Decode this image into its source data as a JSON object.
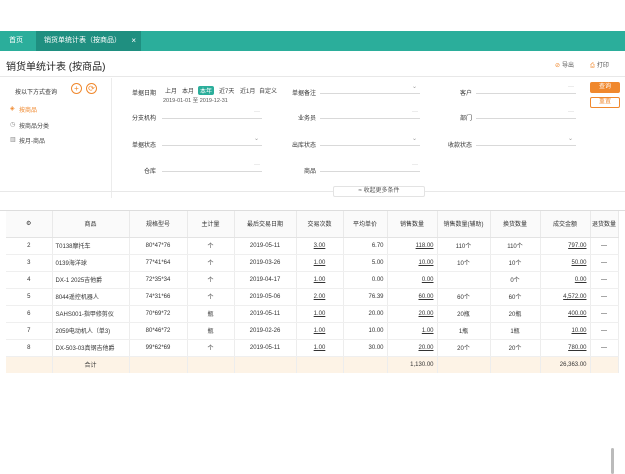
{
  "tabs": {
    "home": "首页",
    "active": "销货单统计表（按商品）",
    "close": "×"
  },
  "page": {
    "title": "销货单统计表 (按商品)",
    "export": "导出",
    "print": "打印"
  },
  "sidebar": {
    "heading": "按以下方式查询",
    "add": "+",
    "refresh": "⟳",
    "items": [
      {
        "label": "按商品",
        "icon": "goods-icon"
      },
      {
        "label": "按商品分类",
        "icon": "clock-icon"
      },
      {
        "label": "按月-商品",
        "icon": "chart-icon"
      }
    ]
  },
  "filters": {
    "doc_date_label": "单据日期",
    "date_options": [
      "上月",
      "本月",
      "本年",
      "近7天",
      "近1月",
      "自定义"
    ],
    "selected_option": "本年",
    "date_start": "2019-01-01",
    "date_end": "2019-12-31",
    "date_sep": "至",
    "doc_remark_label": "单据备注",
    "customer_label": "客户",
    "branch_label": "分支机构",
    "salesman_label": "业务员",
    "department_label": "部门",
    "doc_status_label": "单据状态",
    "outbound_status_label": "出库状态",
    "payment_status_label": "收款状态",
    "warehouse_label": "仓库",
    "goods_label": "商品",
    "query": "查询",
    "reset": "重置",
    "collapse": "收起更多条件"
  },
  "table": {
    "gear": "⚙",
    "columns": [
      "商品",
      "规格型号",
      "主计量",
      "最后交易日期",
      "交易次数",
      "平均单价",
      "销售数量",
      "销售数量(辅助)",
      "换货数量",
      "成交金额",
      "退货数量"
    ],
    "rows": [
      {
        "no": "2",
        "goods": "T0138摩托车",
        "spec": "80*47*76",
        "unit": "个",
        "last_date": "2019-05-11",
        "trades": "3.00",
        "avg_price": "6.70",
        "qty": "118.00",
        "qty_aux": "110个",
        "exchange": "110个",
        "amount": "797.00",
        "ret": "—"
      },
      {
        "no": "3",
        "goods": "0139海洋球",
        "spec": "77*41*64",
        "unit": "个",
        "last_date": "2019-03-26",
        "trades": "1.00",
        "avg_price": "5.00",
        "qty": "10.00",
        "qty_aux": "10个",
        "exchange": "10个",
        "amount": "50.00",
        "ret": "—"
      },
      {
        "no": "4",
        "goods": "DX-1 2025吉他爵",
        "spec": "72*35*34",
        "unit": "个",
        "last_date": "2019-04-17",
        "trades": "1.00",
        "avg_price": "0.00",
        "qty": "0.00",
        "qty_aux": "",
        "exchange": "0个",
        "amount": "0.00",
        "ret": "—"
      },
      {
        "no": "5",
        "goods": "8044遥控机器人",
        "spec": "74*31*66",
        "unit": "个",
        "last_date": "2019-05-06",
        "trades": "2.00",
        "avg_price": "76.39",
        "qty": "60.00",
        "qty_aux": "60个",
        "exchange": "60个",
        "amount": "4,572.00",
        "ret": "—"
      },
      {
        "no": "6",
        "goods": "SAHS001-指甲修剪仪",
        "spec": "70*69*72",
        "unit": "瓶",
        "last_date": "2019-05-11",
        "trades": "1.00",
        "avg_price": "20.00",
        "qty": "20.00",
        "qty_aux": "20瓶",
        "exchange": "20瓶",
        "amount": "400.00",
        "ret": "—"
      },
      {
        "no": "7",
        "goods": "2059电动机人（单3)",
        "spec": "80*46*72",
        "unit": "瓶",
        "last_date": "2019-02-26",
        "trades": "1.00",
        "avg_price": "10.00",
        "qty": "1.00",
        "qty_aux": "1瓶",
        "exchange": "1瓶",
        "amount": "10.00",
        "ret": "—"
      },
      {
        "no": "8",
        "goods": "DX-503-03真钢吉他爵",
        "spec": "99*62*69",
        "unit": "个",
        "last_date": "2019-05-11",
        "trades": "1.00",
        "avg_price": "30.00",
        "qty": "20.00",
        "qty_aux": "20个",
        "exchange": "20个",
        "amount": "780.00",
        "ret": "—"
      }
    ],
    "total_label": "合计",
    "total_qty": "1,130.00",
    "total_amount": "26,363.00"
  }
}
